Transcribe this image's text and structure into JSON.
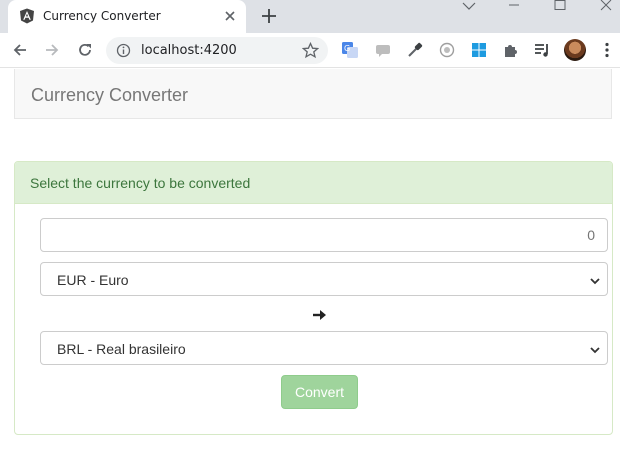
{
  "browser": {
    "tab_title": "Currency Converter",
    "url": "localhost:4200"
  },
  "page": {
    "header_title": "Currency Converter",
    "panel_heading": "Select the currency to be converted",
    "amount_placeholder": "0",
    "from_currency": "EUR - Euro",
    "to_currency": "BRL - Real brasileiro",
    "convert_label": "Convert"
  },
  "colors": {
    "panel_heading_bg": "#dff0d8",
    "panel_heading_text": "#3c763d",
    "convert_button_bg": "#9fd49c"
  }
}
